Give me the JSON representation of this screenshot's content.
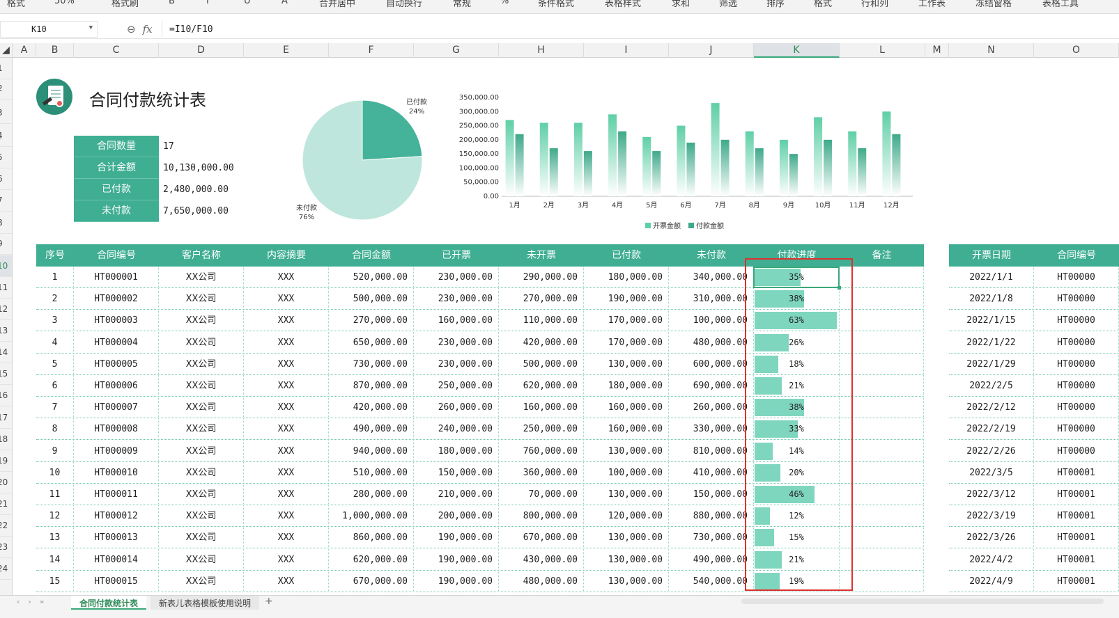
{
  "ribbon": {
    "items": [
      "格式",
      "50%",
      "格式刷",
      "B",
      "I",
      "U",
      "A",
      "合并居中",
      "自动换行",
      "常规",
      "%",
      "条件格式",
      "表格样式",
      "求和",
      "筛选",
      "排序",
      "格式",
      "行和列",
      "工作表",
      "冻结窗格",
      "表格工具"
    ]
  },
  "formula_bar": {
    "cell_ref": "K10",
    "formula": "=I10/F10",
    "zoom_icon": "zoom-icon",
    "fx_label": "fx"
  },
  "columns": [
    "A",
    "B",
    "C",
    "D",
    "E",
    "F",
    "G",
    "H",
    "I",
    "J",
    "K",
    "L",
    "M",
    "N",
    "O"
  ],
  "selected_column": "K",
  "rows": [
    "1",
    "2",
    "3",
    "4",
    "5",
    "6",
    "7",
    "8",
    "9",
    "10",
    "11",
    "12",
    "13",
    "14",
    "15",
    "16",
    "17",
    "18",
    "19",
    "20",
    "21",
    "22",
    "23",
    "24"
  ],
  "selected_row": "10",
  "title": "合同付款统计表",
  "summary": [
    {
      "label": "合同数量",
      "value": "17"
    },
    {
      "label": "合计金额",
      "value": "10,130,000.00"
    },
    {
      "label": "已付款",
      "value": "2,480,000.00"
    },
    {
      "label": "未付款",
      "value": "7,650,000.00"
    }
  ],
  "pie": {
    "slices": [
      {
        "label": "已付款",
        "pct_text": "24%",
        "value": 24,
        "color": "#45b39a"
      },
      {
        "label": "未付款",
        "pct_text": "76%",
        "value": 76,
        "color": "#bfe6dc"
      }
    ]
  },
  "chart_data": {
    "type": "bar",
    "categories": [
      "1月",
      "2月",
      "3月",
      "4月",
      "5月",
      "6月",
      "7月",
      "8月",
      "9月",
      "10月",
      "11月",
      "12月"
    ],
    "series": [
      {
        "name": "开票金额",
        "values": [
          270000,
          260000,
          260000,
          290000,
          210000,
          250000,
          330000,
          230000,
          200000,
          280000,
          230000,
          300000
        ],
        "color": "#5fcfa6"
      },
      {
        "name": "付款金额",
        "values": [
          220000,
          170000,
          160000,
          230000,
          160000,
          190000,
          200000,
          170000,
          150000,
          200000,
          170000,
          220000
        ],
        "color": "#3fa98a"
      }
    ],
    "y_ticks": [
      "0.00",
      "50,000.00",
      "100,000.00",
      "150,000.00",
      "200,000.00",
      "250,000.00",
      "300,000.00",
      "350,000.00"
    ],
    "ylim": [
      0,
      350000
    ],
    "legend": "bottom"
  },
  "table": {
    "headers": [
      "序号",
      "合同编号",
      "客户名称",
      "内容摘要",
      "合同金额",
      "已开票",
      "未开票",
      "已付款",
      "未付款",
      "付款进度",
      "备注"
    ],
    "rows": [
      {
        "no": "1",
        "code": "HT000001",
        "client": "XX公司",
        "desc": "XXX",
        "amount": "520,000.00",
        "invoiced": "230,000.00",
        "uninvoiced": "290,000.00",
        "paid": "180,000.00",
        "unpaid": "340,000.00",
        "progress": "35%",
        "progress_value": 35
      },
      {
        "no": "2",
        "code": "HT000002",
        "client": "XX公司",
        "desc": "XXX",
        "amount": "500,000.00",
        "invoiced": "230,000.00",
        "uninvoiced": "270,000.00",
        "paid": "190,000.00",
        "unpaid": "310,000.00",
        "progress": "38%",
        "progress_value": 38
      },
      {
        "no": "3",
        "code": "HT000003",
        "client": "XX公司",
        "desc": "XXX",
        "amount": "270,000.00",
        "invoiced": "160,000.00",
        "uninvoiced": "110,000.00",
        "paid": "170,000.00",
        "unpaid": "100,000.00",
        "progress": "63%",
        "progress_value": 63
      },
      {
        "no": "4",
        "code": "HT000004",
        "client": "XX公司",
        "desc": "XXX",
        "amount": "650,000.00",
        "invoiced": "230,000.00",
        "uninvoiced": "420,000.00",
        "paid": "170,000.00",
        "unpaid": "480,000.00",
        "progress": "26%",
        "progress_value": 26
      },
      {
        "no": "5",
        "code": "HT000005",
        "client": "XX公司",
        "desc": "XXX",
        "amount": "730,000.00",
        "invoiced": "230,000.00",
        "uninvoiced": "500,000.00",
        "paid": "130,000.00",
        "unpaid": "600,000.00",
        "progress": "18%",
        "progress_value": 18
      },
      {
        "no": "6",
        "code": "HT000006",
        "client": "XX公司",
        "desc": "XXX",
        "amount": "870,000.00",
        "invoiced": "250,000.00",
        "uninvoiced": "620,000.00",
        "paid": "180,000.00",
        "unpaid": "690,000.00",
        "progress": "21%",
        "progress_value": 21
      },
      {
        "no": "7",
        "code": "HT000007",
        "client": "XX公司",
        "desc": "XXX",
        "amount": "420,000.00",
        "invoiced": "260,000.00",
        "uninvoiced": "160,000.00",
        "paid": "160,000.00",
        "unpaid": "260,000.00",
        "progress": "38%",
        "progress_value": 38
      },
      {
        "no": "8",
        "code": "HT000008",
        "client": "XX公司",
        "desc": "XXX",
        "amount": "490,000.00",
        "invoiced": "240,000.00",
        "uninvoiced": "250,000.00",
        "paid": "160,000.00",
        "unpaid": "330,000.00",
        "progress": "33%",
        "progress_value": 33
      },
      {
        "no": "9",
        "code": "HT000009",
        "client": "XX公司",
        "desc": "XXX",
        "amount": "940,000.00",
        "invoiced": "180,000.00",
        "uninvoiced": "760,000.00",
        "paid": "130,000.00",
        "unpaid": "810,000.00",
        "progress": "14%",
        "progress_value": 14
      },
      {
        "no": "10",
        "code": "HT000010",
        "client": "XX公司",
        "desc": "XXX",
        "amount": "510,000.00",
        "invoiced": "150,000.00",
        "uninvoiced": "360,000.00",
        "paid": "100,000.00",
        "unpaid": "410,000.00",
        "progress": "20%",
        "progress_value": 20
      },
      {
        "no": "11",
        "code": "HT000011",
        "client": "XX公司",
        "desc": "XXX",
        "amount": "280,000.00",
        "invoiced": "210,000.00",
        "uninvoiced": "70,000.00",
        "paid": "130,000.00",
        "unpaid": "150,000.00",
        "progress": "46%",
        "progress_value": 46
      },
      {
        "no": "12",
        "code": "HT000012",
        "client": "XX公司",
        "desc": "XXX",
        "amount": "1,000,000.00",
        "invoiced": "200,000.00",
        "uninvoiced": "800,000.00",
        "paid": "120,000.00",
        "unpaid": "880,000.00",
        "progress": "12%",
        "progress_value": 12
      },
      {
        "no": "13",
        "code": "HT000013",
        "client": "XX公司",
        "desc": "XXX",
        "amount": "860,000.00",
        "invoiced": "190,000.00",
        "uninvoiced": "670,000.00",
        "paid": "130,000.00",
        "unpaid": "730,000.00",
        "progress": "15%",
        "progress_value": 15
      },
      {
        "no": "14",
        "code": "HT000014",
        "client": "XX公司",
        "desc": "XXX",
        "amount": "620,000.00",
        "invoiced": "190,000.00",
        "uninvoiced": "430,000.00",
        "paid": "130,000.00",
        "unpaid": "490,000.00",
        "progress": "21%",
        "progress_value": 21
      },
      {
        "no": "15",
        "code": "HT000015",
        "client": "XX公司",
        "desc": "XXX",
        "amount": "670,000.00",
        "invoiced": "190,000.00",
        "uninvoiced": "480,000.00",
        "paid": "130,000.00",
        "unpaid": "540,000.00",
        "progress": "19%",
        "progress_value": 19
      }
    ]
  },
  "side_table": {
    "headers": [
      "开票日期",
      "合同编号"
    ],
    "rows": [
      [
        "2022/1/1",
        "HT00000"
      ],
      [
        "2022/1/8",
        "HT00000"
      ],
      [
        "2022/1/15",
        "HT00000"
      ],
      [
        "2022/1/22",
        "HT00000"
      ],
      [
        "2022/1/29",
        "HT00000"
      ],
      [
        "2022/2/5",
        "HT00000"
      ],
      [
        "2022/2/12",
        "HT00000"
      ],
      [
        "2022/2/19",
        "HT00000"
      ],
      [
        "2022/2/26",
        "HT00000"
      ],
      [
        "2022/3/5",
        "HT00001"
      ],
      [
        "2022/3/12",
        "HT00001"
      ],
      [
        "2022/3/19",
        "HT00001"
      ],
      [
        "2022/3/26",
        "HT00001"
      ],
      [
        "2022/4/2",
        "HT00001"
      ],
      [
        "2022/4/9",
        "HT00001"
      ]
    ]
  },
  "sheet_tabs": {
    "active": "合同付款统计表",
    "other": "新表儿表格模板使用说明",
    "add": "+"
  }
}
